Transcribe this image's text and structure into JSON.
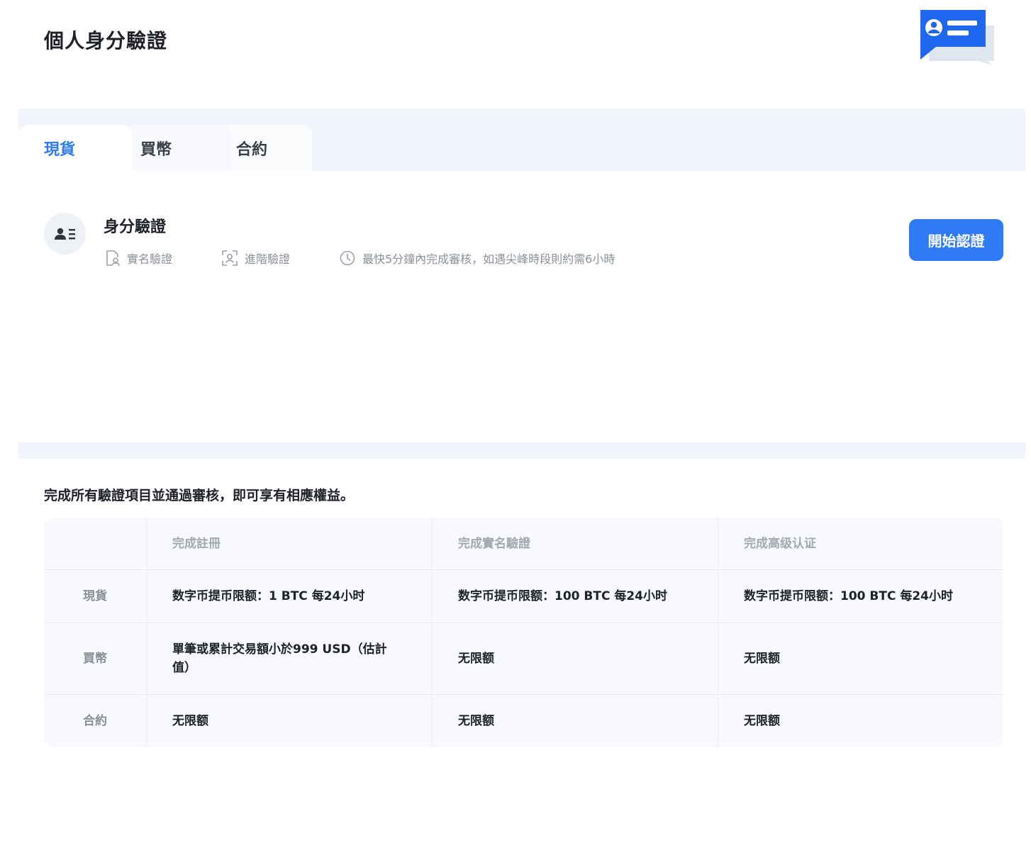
{
  "header": {
    "title": "個人身分驗證"
  },
  "tabs": [
    {
      "label": "現貨",
      "active": true
    },
    {
      "label": "買幣",
      "active": false
    },
    {
      "label": "合約",
      "active": false
    }
  ],
  "verification": {
    "title": "身分驗證",
    "items": [
      {
        "icon": "id-card-icon",
        "label": "實名驗證"
      },
      {
        "icon": "face-scan-icon",
        "label": "進階驗證"
      },
      {
        "icon": "clock-icon",
        "label": "最快5分鐘內完成審核，如遇尖峰時段則約需6小時"
      }
    ],
    "button_label": "開始認證"
  },
  "benefits": {
    "caption": "完成所有驗證項目並通過審核，即可享有相應權益。",
    "columns": [
      "",
      "完成註冊",
      "完成實名驗證",
      "完成高级认证"
    ],
    "rows": [
      {
        "label": "現貨",
        "cells": [
          "数字币提币限额：1 BTC 每24小时",
          "数字币提币限额：100 BTC 每24小时",
          "数字币提币限额：100 BTC 每24小时"
        ]
      },
      {
        "label": "買幣",
        "cells": [
          "單筆或累計交易額小於999 USD（估計值）",
          "无限额",
          "无限额"
        ]
      },
      {
        "label": "合約",
        "cells": [
          "无限额",
          "无限额",
          "无限额"
        ]
      }
    ]
  },
  "colors": {
    "accent": "#2f7bf6",
    "band": "#f1f5fb",
    "table_bg": "#f7f9fc",
    "muted": "#8a8f99"
  }
}
